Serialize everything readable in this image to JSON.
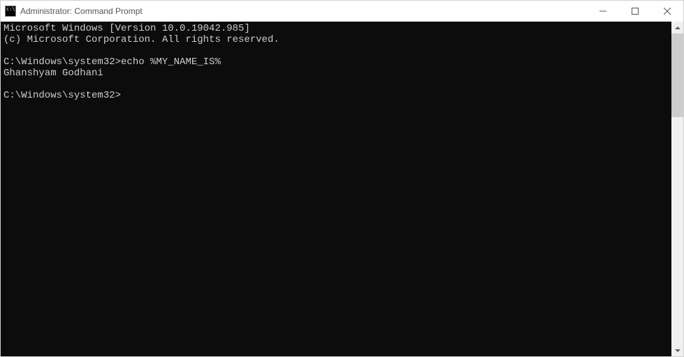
{
  "window": {
    "title": "Administrator: Command Prompt"
  },
  "terminal": {
    "header1": "Microsoft Windows [Version 10.0.19042.985]",
    "header2": "(c) Microsoft Corporation. All rights reserved.",
    "prompt1": "C:\\Windows\\system32>",
    "command1": "echo %MY_NAME_IS%",
    "output1": "Ghanshyam Godhani",
    "prompt2": "C:\\Windows\\system32>"
  }
}
